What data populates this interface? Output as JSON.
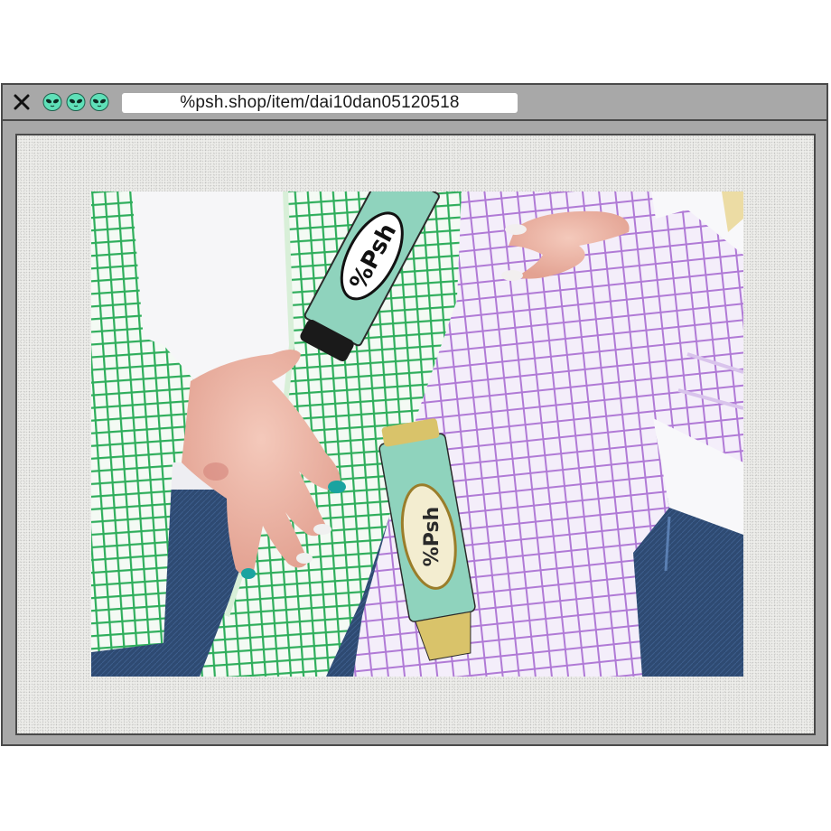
{
  "window": {
    "address_bar": {
      "url": "%psh.shop/item/dai10dan05120518"
    },
    "controls": {
      "close_icon": "close-x-icon",
      "alien_icons": [
        "alien-icon",
        "alien-icon",
        "alien-icon"
      ],
      "alien_color": "#5fe0b8"
    }
  },
  "content": {
    "photo": {
      "shirt_colors": {
        "green_check": "#2fae5c",
        "purple_check": "#b07ad6",
        "patch_mint": "#8fd3bd",
        "patch_gold": "#d9c36a",
        "denim": "#3a5a86"
      },
      "patch_text_green_shirt": "%Psh",
      "patch_text_purple_shirt": "%Psh"
    }
  }
}
